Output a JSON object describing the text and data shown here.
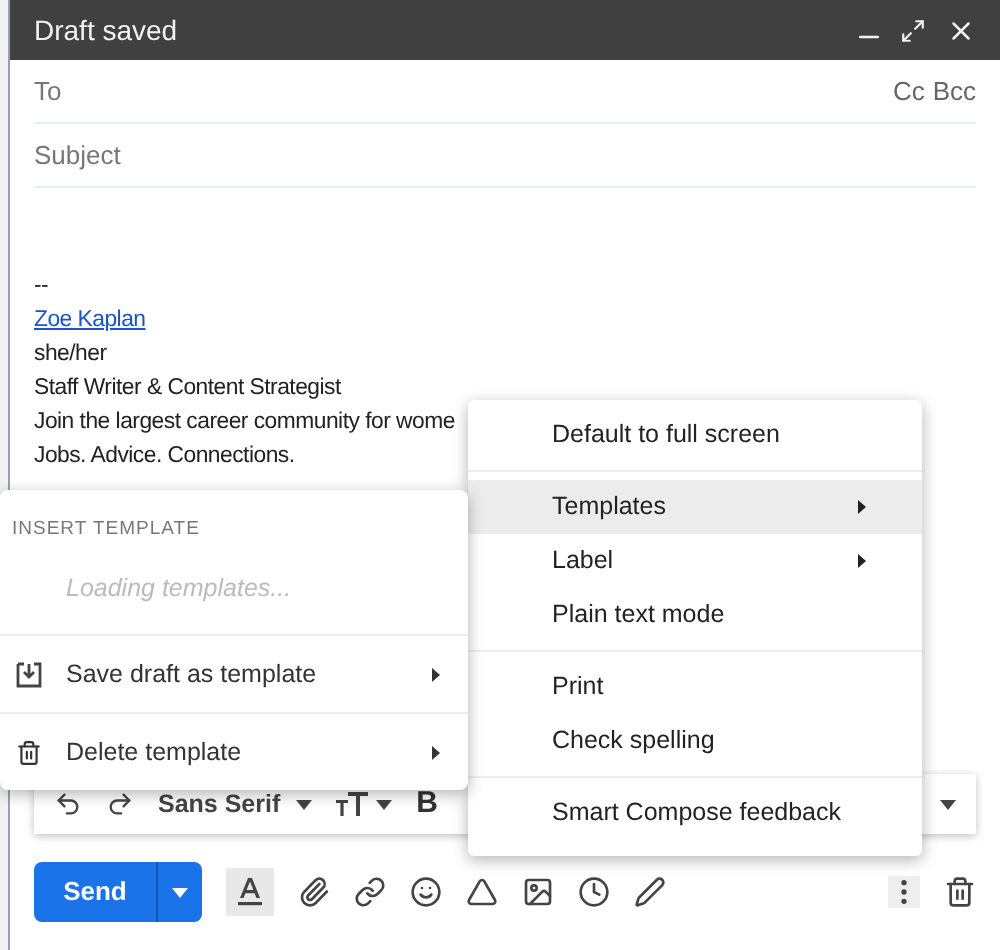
{
  "window": {
    "title": "Draft saved"
  },
  "to": {
    "placeholder": "To"
  },
  "recipient_links": [
    "Cc",
    "Bcc"
  ],
  "subject": {
    "placeholder": "Subject"
  },
  "signature": [
    {
      "kind": "text",
      "text": "--"
    },
    {
      "kind": "link",
      "text": "Zoe Kaplan"
    },
    {
      "kind": "text",
      "text": "she/her"
    },
    {
      "kind": "text",
      "text": "Staff Writer & Content Strategist"
    },
    {
      "kind": "text",
      "text": "Join the largest career community for wome"
    },
    {
      "kind": "text",
      "text": "Jobs. Advice. Connections."
    }
  ],
  "format_toolbar": {
    "font": "Sans Serif",
    "bold": "B"
  },
  "send_button": {
    "label": "Send"
  },
  "formatting_toggle": {
    "selected": true
  },
  "more_menu": {
    "groups": [
      [
        {
          "label": "Default to full screen",
          "submenu": false,
          "selected": false
        }
      ],
      [
        {
          "label": "Templates",
          "submenu": true,
          "selected": true
        },
        {
          "label": "Label",
          "submenu": true,
          "selected": false
        },
        {
          "label": "Plain text mode",
          "submenu": false,
          "selected": false
        }
      ],
      [
        {
          "label": "Print",
          "submenu": false,
          "selected": false
        },
        {
          "label": "Check spelling",
          "submenu": false,
          "selected": false
        }
      ],
      [
        {
          "label": "Smart Compose feedback",
          "submenu": false,
          "selected": false
        }
      ]
    ]
  },
  "template_menu": {
    "heading": "INSERT TEMPLATE",
    "loading": "Loading templates...",
    "items": [
      {
        "kind": "save",
        "label": "Save draft as template",
        "submenu": true
      },
      {
        "kind": "delete",
        "label": "Delete template",
        "submenu": true
      }
    ]
  }
}
